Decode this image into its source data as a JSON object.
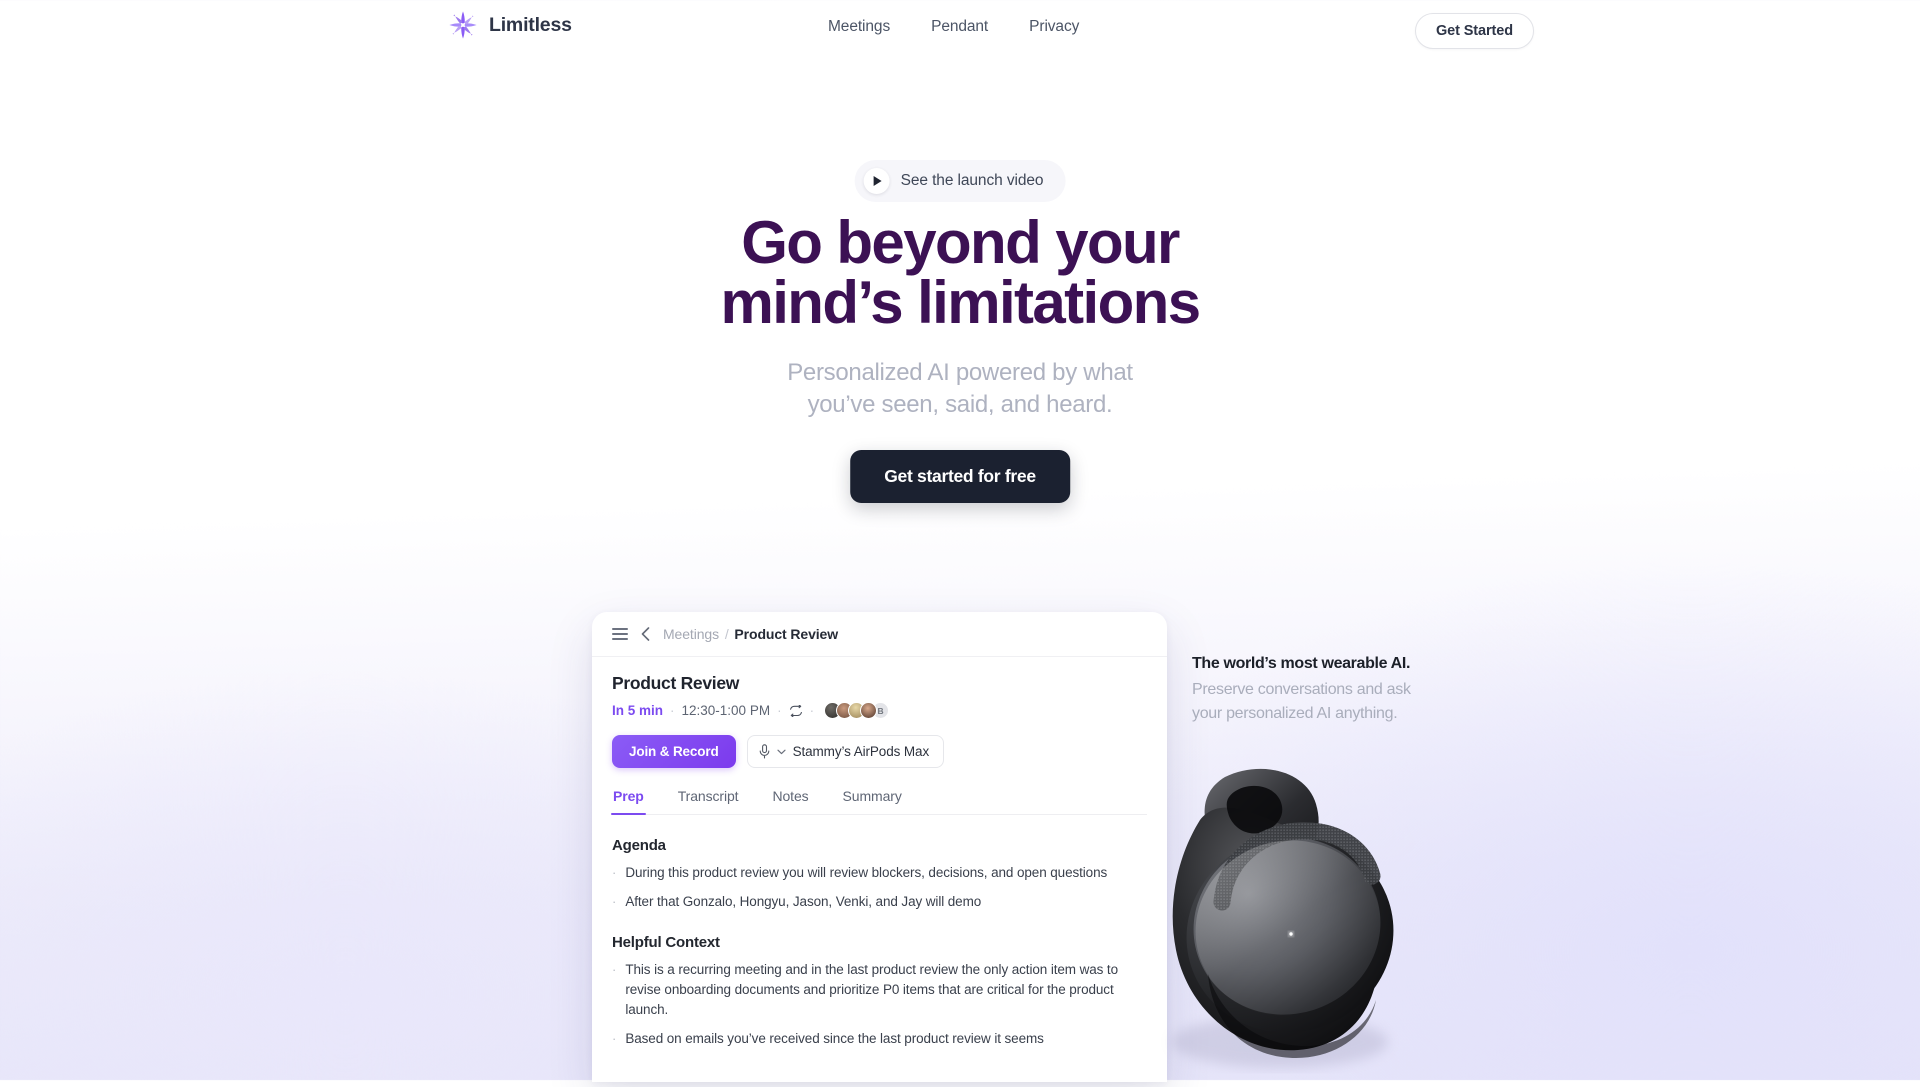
{
  "brand": {
    "name": "Limitless",
    "logo_icon": "star-burst-icon",
    "accent": "#7c4bf0",
    "headline_color": "#3c1154"
  },
  "nav": {
    "links": [
      {
        "label": "Meetings"
      },
      {
        "label": "Pendant"
      },
      {
        "label": "Privacy"
      }
    ],
    "cta_label": "Get Started"
  },
  "hero": {
    "video_pill": {
      "label": "See the launch video",
      "icon": "play-icon"
    },
    "headline_line1": "Go beyond your",
    "headline_line2": "mind’s limitations",
    "subhead_line1": "Personalized AI powered by what",
    "subhead_line2": "you’ve seen, said, and heard.",
    "cta_label": "Get started for free"
  },
  "app": {
    "topbar": {
      "menu_icon": "hamburger-menu-icon",
      "back_icon": "chevron-left-icon",
      "breadcrumb_parent": "Meetings",
      "breadcrumb_separator": "/",
      "breadcrumb_current": "Product Review"
    },
    "meeting": {
      "title": "Product Review",
      "starts_in": "In 5 min",
      "time_range": "12:30-1:00 PM",
      "recurring_icon": "repeat-icon",
      "separator": "·",
      "attendee_overflow_label": "B",
      "attendee_count": 5
    },
    "actions": {
      "join_label": "Join & Record",
      "mic_icon": "microphone-icon",
      "chevron_icon": "chevron-down-icon",
      "device_label": "Stammy’s AirPods Max"
    },
    "tabs": [
      {
        "label": "Prep",
        "active": true
      },
      {
        "label": "Transcript",
        "active": false
      },
      {
        "label": "Notes",
        "active": false
      },
      {
        "label": "Summary",
        "active": false
      }
    ],
    "sections": [
      {
        "heading": "Agenda",
        "bullets": [
          "During this product review you will review blockers, decisions, and open questions",
          "After that Gonzalo, Hongyu, Jason, Venki, and Jay will demo"
        ]
      },
      {
        "heading": "Helpful Context",
        "bullets": [
          "This is a recurring meeting and in the last product review the only action item was to revise onboarding documents and prioritize P0 items that are critical for the product launch.",
          "Based on emails you’ve received since the last product review it seems"
        ]
      }
    ]
  },
  "side": {
    "heading": "The world’s most wearable AI.",
    "body_line1": "Preserve conversations and ask",
    "body_line2": "your personalized AI anything."
  },
  "device_image": {
    "name": "limitless-pendant",
    "led_color": "#ffffff",
    "body_color": "#1c1c1e"
  }
}
